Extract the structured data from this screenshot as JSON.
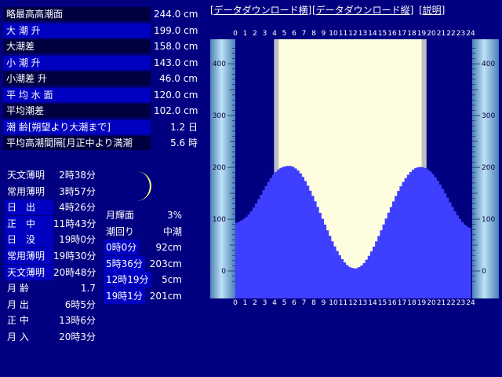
{
  "stats": [
    {
      "label": "略最高高潮面",
      "value": "244.0 cm"
    },
    {
      "label": "大 潮 升",
      "value": "199.0 cm"
    },
    {
      "label": "大潮差",
      "value": "158.0 cm"
    },
    {
      "label": "小 潮 升",
      "value": "143.0 cm"
    },
    {
      "label": "小潮差 升",
      "value": "46.0 cm"
    },
    {
      "label": "平 均 水 面",
      "value": "120.0 cm"
    },
    {
      "label": "平均潮差",
      "value": "102.0 cm"
    },
    {
      "label": "潮 齢[朔望より大潮まで]",
      "value": "1.2 日"
    },
    {
      "label": "平均高潮間隔[月正中より満潮",
      "value": "5.6 時"
    }
  ],
  "sun_moon": [
    {
      "label": "天文薄明",
      "value": "2時38分"
    },
    {
      "label": "常用薄明",
      "value": "3時57分"
    },
    {
      "label": "日　出",
      "value": "4時26分"
    },
    {
      "label": "正　中",
      "value": "11時43分"
    },
    {
      "label": "日　没",
      "value": "19時0分"
    },
    {
      "label": "常用薄明",
      "value": "19時30分"
    },
    {
      "label": "天文薄明",
      "value": "20時48分"
    },
    {
      "label": "月 齢",
      "value": "1.7"
    },
    {
      "label": "月 出",
      "value": "6時5分"
    },
    {
      "label": "正 中",
      "value": "13時6分"
    },
    {
      "label": "月 入",
      "value": "20時3分"
    }
  ],
  "moon_info": [
    {
      "label": "月輝面",
      "value": "3%"
    },
    {
      "label": "潮回り",
      "value": "中潮"
    },
    {
      "label": "0時0分",
      "value": "92cm"
    },
    {
      "label": "5時36分",
      "value": "203cm"
    },
    {
      "label": "12時19分",
      "value": "5cm"
    },
    {
      "label": "19時1分",
      "value": "201cm"
    }
  ],
  "links": {
    "download_h": "[データダウンロード横]",
    "download_v": "[データダウンロード縦]",
    "explain": "[説明]"
  },
  "colors": {
    "background": "#000080",
    "tide_fill": "#3f3fff",
    "daylight": "#fffde0",
    "twilight": "#c0c0c0",
    "night": "#000080"
  },
  "chart_data": {
    "type": "area",
    "x_ticks": [
      "0",
      "1",
      "2",
      "3",
      "4",
      "5",
      "6",
      "7",
      "8",
      "9",
      "10",
      "11",
      "12",
      "13",
      "14",
      "15",
      "16",
      "17",
      "18",
      "19",
      "20",
      "21",
      "22",
      "23",
      "24"
    ],
    "y_ticks": [
      "0",
      "100",
      "200",
      "300",
      "400"
    ],
    "xlim": [
      0,
      24
    ],
    "ylim": [
      -20,
      440
    ],
    "sunrise_hour": 4.43,
    "sunset_hour": 19.0,
    "civil_twilight": [
      3.95,
      19.5
    ],
    "series": [
      {
        "x": [
          0,
          0.5,
          1,
          1.5,
          2,
          2.5,
          3,
          3.5,
          4,
          4.5,
          5,
          5.5,
          5.6,
          6,
          6.5,
          7,
          7.5,
          8,
          8.5,
          9,
          9.5,
          10,
          10.5,
          11,
          11.5,
          12,
          12.32,
          12.5,
          13,
          13.5,
          14,
          14.5,
          15,
          15.5,
          16,
          16.5,
          17,
          17.5,
          18,
          18.5,
          19,
          19.02,
          19.5,
          20,
          20.5,
          21,
          21.5,
          22,
          22.5,
          23,
          23.5,
          24
        ],
        "y": [
          92,
          96,
          102,
          112,
          126,
          143,
          160,
          176,
          189,
          198,
          202,
          203,
          203,
          200,
          192,
          178,
          160,
          140,
          118,
          95,
          73,
          52,
          34,
          19,
          9,
          5,
          5,
          6,
          12,
          25,
          42,
          62,
          84,
          107,
          129,
          150,
          168,
          183,
          194,
          200,
          201,
          201,
          198,
          190,
          178,
          163,
          146,
          128,
          111,
          97,
          87,
          82
        ]
      }
    ]
  }
}
